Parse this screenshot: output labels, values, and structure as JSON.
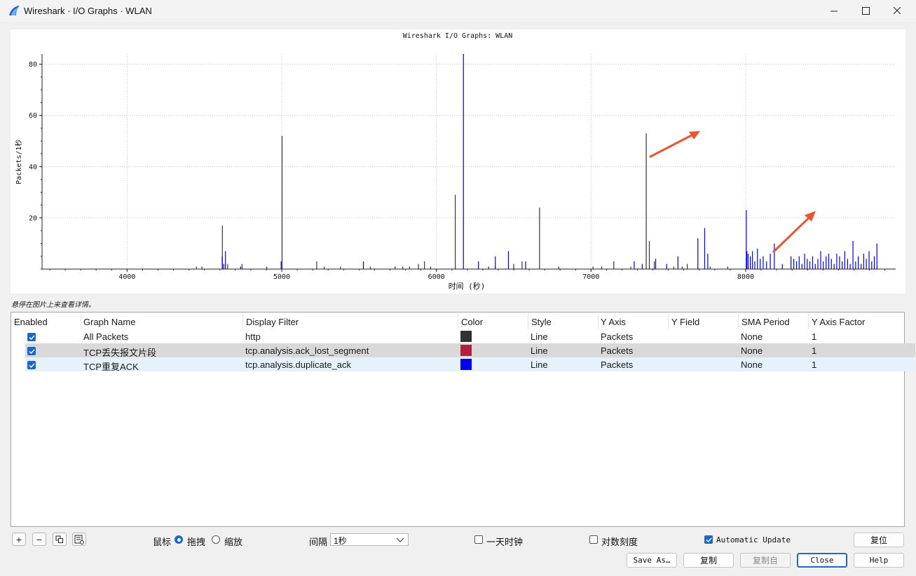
{
  "window": {
    "title": "Wireshark · I/O Graphs · WLAN",
    "icon": "wireshark-fin-icon",
    "controls": [
      "minimize-icon",
      "maximize-icon",
      "close-icon"
    ]
  },
  "hint_text": "悬停在图片上来查看详情。",
  "chart_data": {
    "type": "bar",
    "title": "Wireshark I/O Graphs: WLAN",
    "xlabel": "时间 (秒)",
    "ylabel": "Packets/1秒",
    "xlim": [
      3450,
      8970
    ],
    "ylim": [
      0,
      84
    ],
    "xticks": [
      4000,
      5000,
      6000,
      7000,
      8000
    ],
    "yticks": [
      20,
      40,
      60,
      80
    ],
    "grid": true,
    "colors": {
      "all_packets": "#333333",
      "tcp_lost_segment": "#b3203f",
      "tcp_dup_ack": "#0000ee",
      "annotation_arrow": "#e8552f"
    },
    "series": [
      {
        "name": "All Packets",
        "color": "#333333",
        "x": [
          4448,
          4484,
          4616,
          4650,
          4743,
          4903,
          5002,
          5226,
          5275,
          5380,
          5573,
          5733,
          5782,
          5826,
          5884,
          5923,
          5963,
          6122,
          6338,
          6380,
          6500,
          6554,
          6667,
          6791,
          7013,
          7069,
          7147,
          7257,
          7357,
          7377,
          7409,
          7535,
          7589,
          7622,
          7771,
          7884
        ],
        "y": [
          1,
          1,
          17,
          2,
          2,
          1,
          52,
          3,
          1,
          1,
          1,
          1,
          1,
          1,
          2,
          3,
          1,
          29,
          1,
          1,
          2,
          3,
          24,
          1,
          1,
          1,
          3,
          1,
          53,
          11,
          3,
          1,
          1,
          2,
          1,
          1
        ]
      },
      {
        "name": "TCP丢失报文片段",
        "color": "#b3203f",
        "x": [],
        "y": []
      },
      {
        "name": "TCP重复ACK",
        "color": "#0000ee",
        "x": [
          4615,
          4625,
          4636,
          4734,
          4996,
          5528,
          6175,
          6272,
          6381,
          6466,
          6577,
          7279,
          7331,
          7418,
          7489,
          7562,
          7691,
          7735,
          7755,
          8004,
          8008,
          8016,
          8030,
          8044,
          8059,
          8076,
          8094,
          8113,
          8135,
          8159,
          8185,
          8237,
          8293,
          8311,
          8329,
          8346,
          8364,
          8381,
          8398,
          8415,
          8433,
          8450,
          8467,
          8485,
          8502,
          8520,
          8537,
          8554,
          8572,
          8589,
          8607,
          8624,
          8641,
          8659,
          8676,
          8694,
          8711,
          8728,
          8746,
          8763,
          8780,
          8798,
          8815,
          8832,
          8849
        ],
        "y": [
          5,
          2,
          7,
          1,
          3,
          3,
          84,
          3,
          5,
          7,
          3,
          3,
          2,
          4,
          2,
          5,
          12,
          16,
          6,
          23,
          7,
          6,
          5,
          7,
          3,
          8,
          4,
          5,
          3,
          6,
          10,
          2,
          5,
          4,
          3,
          5,
          2,
          6,
          4,
          3,
          5,
          2,
          4,
          7,
          3,
          5,
          6,
          4,
          2,
          6,
          5,
          3,
          7,
          4,
          2,
          11,
          3,
          5,
          2,
          6,
          4,
          7,
          3,
          5,
          10
        ]
      }
    ]
  },
  "table": {
    "headers": [
      "Enabled",
      "Graph Name",
      "Display Filter",
      "Color",
      "Style",
      "Y Axis",
      "Y Field",
      "SMA Period",
      "Y Axis Factor"
    ],
    "rows": [
      {
        "enabled": true,
        "name": "All Packets",
        "filter": "http",
        "color": "#333333",
        "style": "Line",
        "y_axis": "Packets",
        "y_field": "",
        "sma": "None",
        "factor": "1"
      },
      {
        "enabled": true,
        "name": "TCP丢失报文片段",
        "filter": "tcp.analysis.ack_lost_segment",
        "color": "#b3203f",
        "style": "Line",
        "y_axis": "Packets",
        "y_field": "",
        "sma": "None",
        "factor": "1"
      },
      {
        "enabled": true,
        "name": "TCP重复ACK",
        "filter": "tcp.analysis.duplicate_ack",
        "color": "#0000ee",
        "style": "Line",
        "y_axis": "Packets",
        "y_field": "",
        "sma": "None",
        "factor": "1"
      }
    ]
  },
  "toolbar": {
    "add": "+",
    "remove": "−",
    "mouse_label": "鼠标",
    "drag_label": "拖拽",
    "zoom_label": "缩放",
    "mouse_mode": "drag",
    "interval_label": "间隔",
    "interval_value": "1秒",
    "time_of_day_label": "一天时钟",
    "time_of_day_checked": false,
    "log_scale_label": "对数刻度",
    "log_scale_checked": false,
    "auto_update_label": "Automatic Update",
    "auto_update_checked": true,
    "reset_label": "复位"
  },
  "buttons": {
    "save_as": "Save As…",
    "copy": "复制",
    "copy_from": "复制自",
    "close": "Close",
    "help": "Help"
  }
}
